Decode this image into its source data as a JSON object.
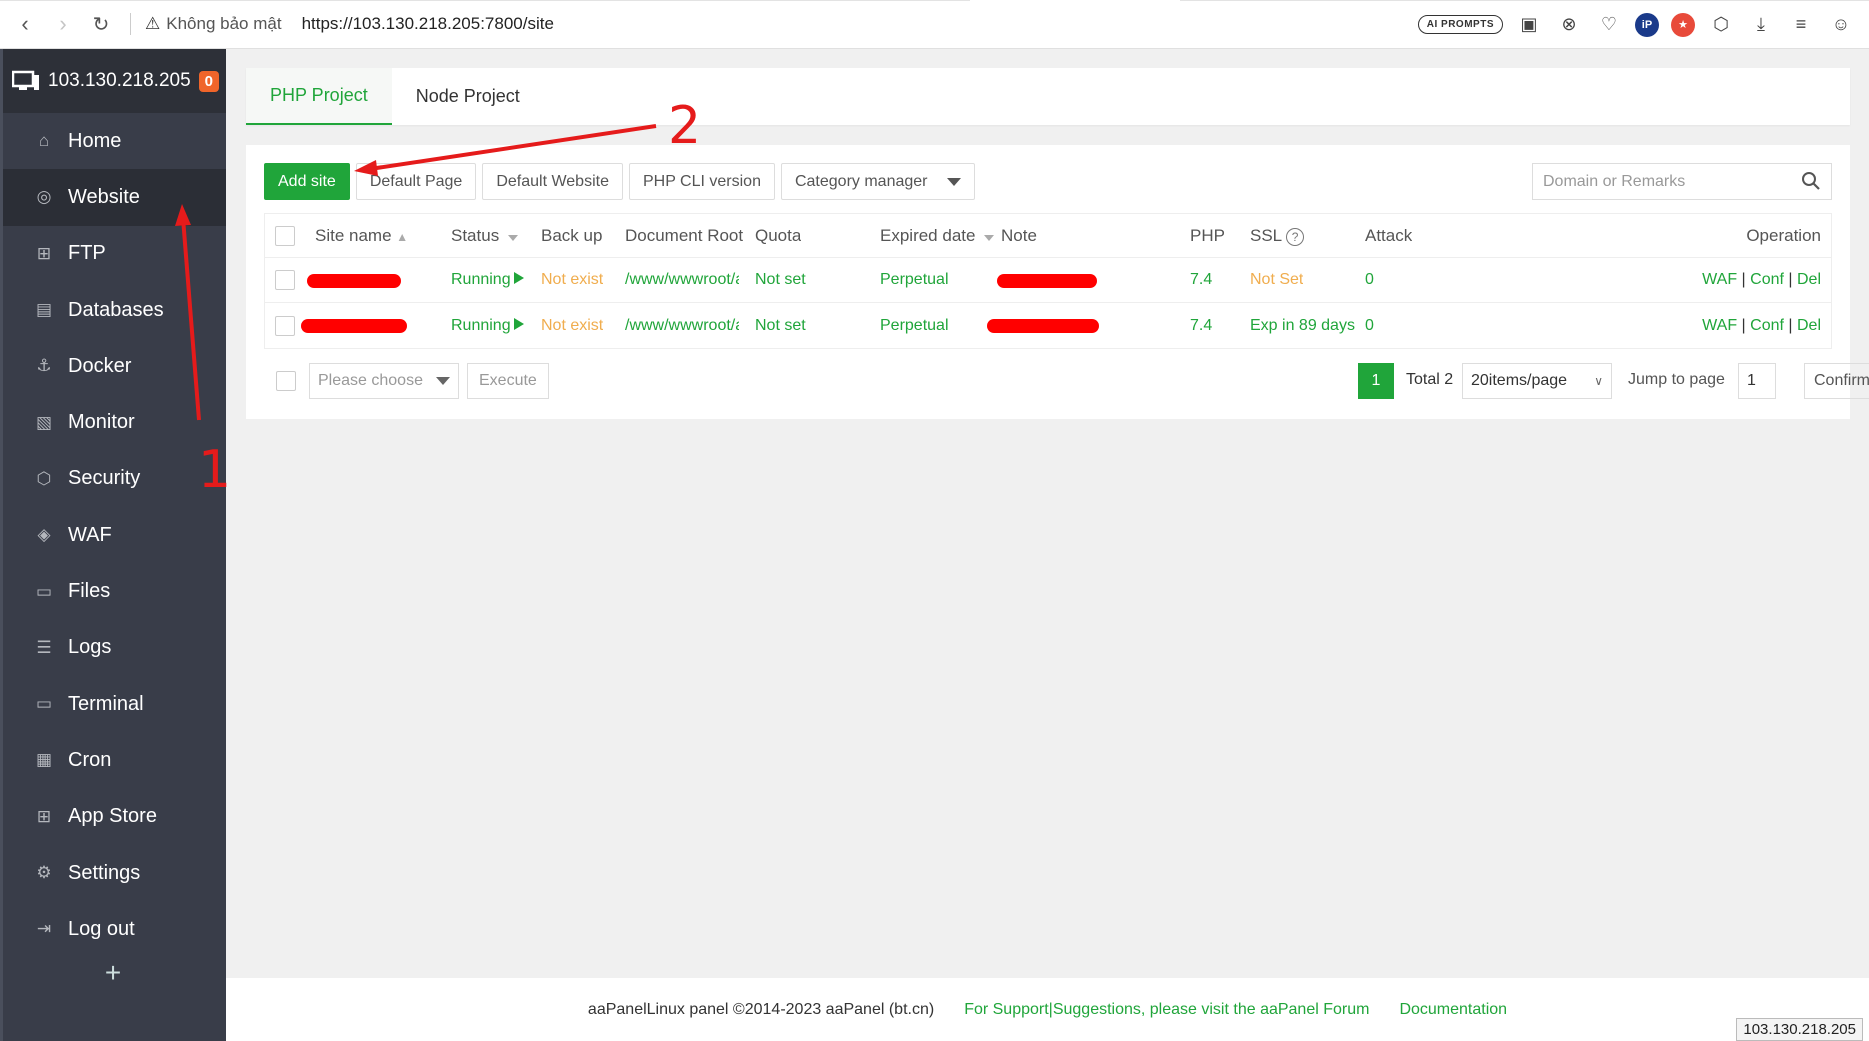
{
  "browser": {
    "security_label": "Không bảo mật",
    "url": "https://103.130.218.205:7800/site",
    "ai_prompts": "AI PROMPTS"
  },
  "sidebar": {
    "server_ip": "103.130.218.205",
    "badge": "0",
    "items": [
      {
        "label": "Home",
        "icon": "home-icon"
      },
      {
        "label": "Website",
        "icon": "globe-icon"
      },
      {
        "label": "FTP",
        "icon": "ftp-icon"
      },
      {
        "label": "Databases",
        "icon": "database-icon"
      },
      {
        "label": "Docker",
        "icon": "docker-icon"
      },
      {
        "label": "Monitor",
        "icon": "monitor-icon"
      },
      {
        "label": "Security",
        "icon": "shield-icon"
      },
      {
        "label": "WAF",
        "icon": "waf-icon"
      },
      {
        "label": "Files",
        "icon": "folder-icon"
      },
      {
        "label": "Logs",
        "icon": "logs-icon"
      },
      {
        "label": "Terminal",
        "icon": "terminal-icon"
      },
      {
        "label": "Cron",
        "icon": "calendar-icon"
      },
      {
        "label": "App Store",
        "icon": "apps-icon"
      },
      {
        "label": "Settings",
        "icon": "gear-icon"
      },
      {
        "label": "Log out",
        "icon": "logout-icon"
      }
    ],
    "active_item": "Website",
    "add": "+"
  },
  "tabs": [
    "PHP Project",
    "Node Project"
  ],
  "toolbar": {
    "add_site": "Add site",
    "default_page": "Default Page",
    "default_website": "Default Website",
    "php_cli": "PHP CLI version",
    "category_manager": "Category manager",
    "search_placeholder": "Domain or Remarks"
  },
  "table": {
    "headers": {
      "site_name": "Site name",
      "status": "Status",
      "backup": "Back up",
      "doc_root": "Document Root",
      "quota": "Quota",
      "expired": "Expired date",
      "note": "Note",
      "php": "PHP",
      "ssl": "SSL",
      "attack": "Attack",
      "operation": "Operation"
    },
    "rows": [
      {
        "status": "Running",
        "backup": "Not exist",
        "doc_root": "/www/wwwroot/ak",
        "quota": "Not set",
        "expired": "Perpetual",
        "php": "7.4",
        "ssl": "Not Set",
        "attack": "0",
        "op_waf": "WAF",
        "op_conf": "Conf",
        "op_del": "Del"
      },
      {
        "status": "Running",
        "backup": "Not exist",
        "doc_root": "/www/wwwroot/ak",
        "quota": "Not set",
        "expired": "Perpetual",
        "php": "7.4",
        "ssl": "Exp in 89 days",
        "attack": "0",
        "op_waf": "WAF",
        "op_conf": "Conf",
        "op_del": "Del"
      }
    ]
  },
  "batch": {
    "placeholder": "Please choose",
    "execute": "Execute"
  },
  "pagination": {
    "current": "1",
    "total": "Total 2",
    "per_page": "20items/page",
    "jump_label": "Jump to page",
    "jump_value": "1",
    "confirm": "Confirm"
  },
  "footer": {
    "copyright": "aaPanelLinux panel ©2014-2023 aaPanel (bt.cn)",
    "support": "For Support|Suggestions, please visit the aaPanel Forum",
    "docs": "Documentation",
    "status_ip": "103.130.218.205"
  },
  "annotations": {
    "one": "1",
    "two": "2"
  },
  "colors": {
    "accent": "#20a53a",
    "sidebar": "#393d49",
    "warning": "#f0ad4e",
    "annotation": "#e51b1b"
  }
}
